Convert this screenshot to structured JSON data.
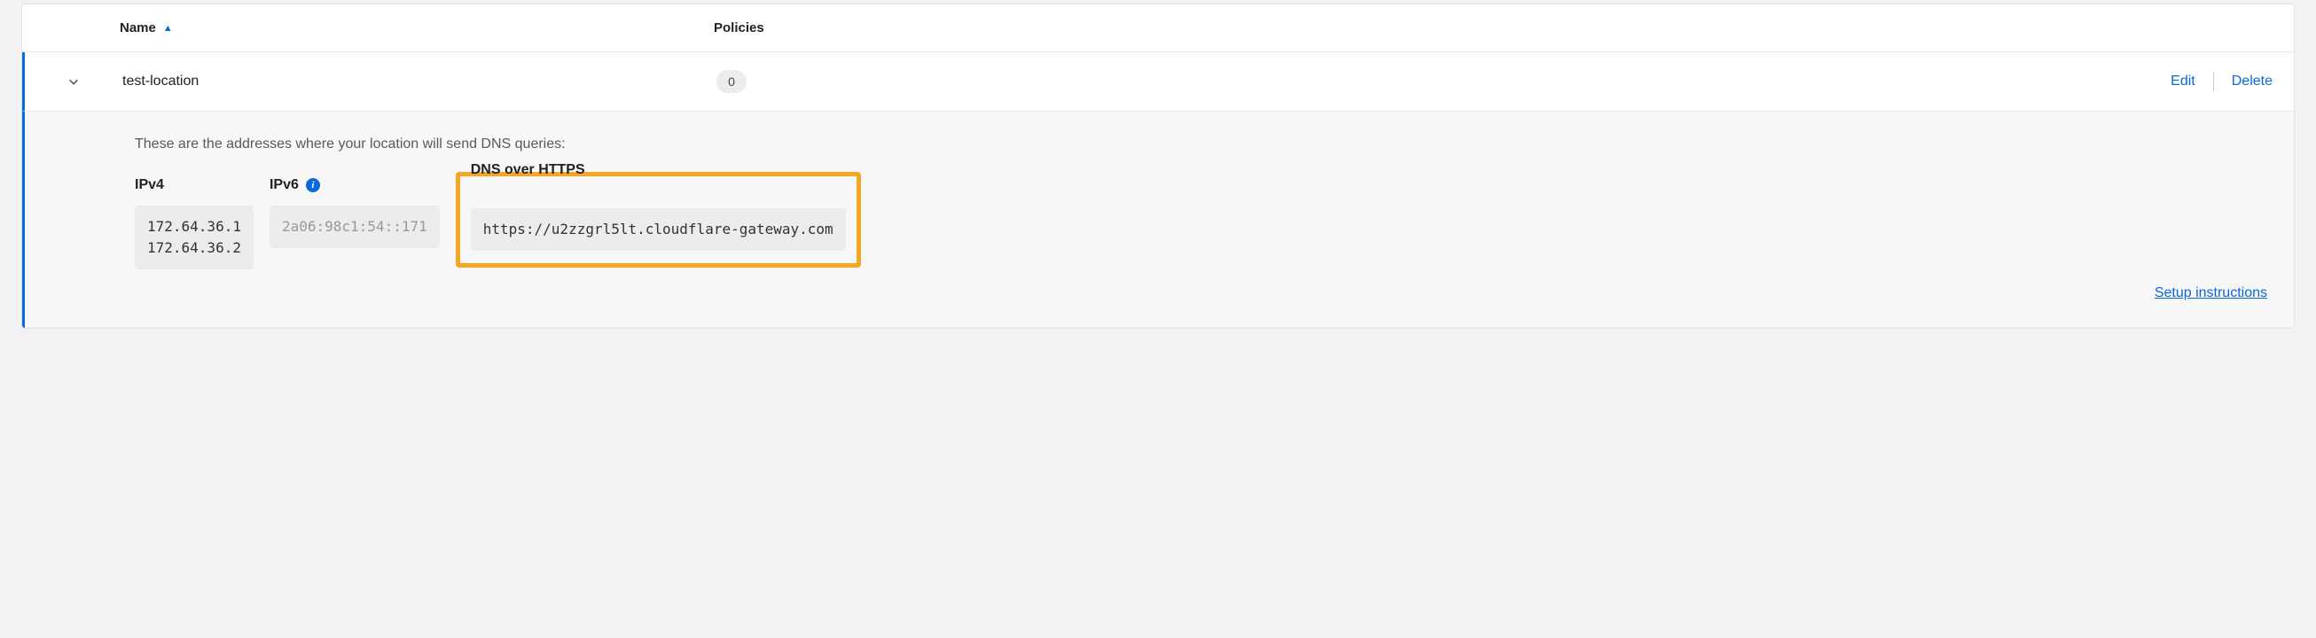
{
  "table": {
    "headers": {
      "name": "Name",
      "policies": "Policies"
    }
  },
  "location": {
    "name": "test-location",
    "policies_count": "0",
    "actions": {
      "edit": "Edit",
      "delete": "Delete"
    }
  },
  "details": {
    "intro": "These are the addresses where your location will send DNS queries:",
    "ipv4": {
      "label": "IPv4",
      "value": "172.64.36.1\n172.64.36.2"
    },
    "ipv6": {
      "label": "IPv6",
      "value": "2a06:98c1:54::171"
    },
    "doh": {
      "label": "DNS over HTTPS",
      "value": "https://u2zzgrl5lt.cloudflare-gateway.com"
    },
    "setup_link": "Setup instructions"
  }
}
